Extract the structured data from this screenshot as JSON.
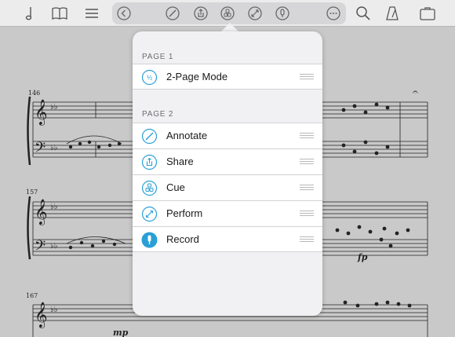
{
  "toolbar": {
    "left_icons": [
      "music-note-icon",
      "book-icon",
      "list-icon"
    ],
    "center_icons": [
      "back-arrow-icon",
      "annotate-icon",
      "share-icon",
      "cue-icon",
      "perform-icon",
      "record-icon",
      "more-icon"
    ],
    "right_icons": [
      "search-icon",
      "metronome-icon",
      "briefcase-icon"
    ]
  },
  "score": {
    "measure_numbers": [
      "146",
      "157",
      "167"
    ],
    "dynamics": [
      "fp",
      "mp"
    ]
  },
  "menu": {
    "sections": [
      {
        "header": "PAGE 1",
        "items": [
          {
            "label": "2-Page Mode",
            "icon": "half-icon",
            "glyph": "½"
          }
        ]
      },
      {
        "header": "PAGE 2",
        "items": [
          {
            "label": "Annotate",
            "icon": "annotate-icon"
          },
          {
            "label": "Share",
            "icon": "share-icon"
          },
          {
            "label": "Cue",
            "icon": "cue-icon"
          },
          {
            "label": "Perform",
            "icon": "perform-icon"
          },
          {
            "label": "Record",
            "icon": "record-icon"
          }
        ]
      }
    ]
  },
  "colors": {
    "accent": "#2a9fd6",
    "toolbar_bg": "#ececec",
    "score_bg": "#c9c9c9",
    "popover_bg": "#f1f1f3"
  }
}
